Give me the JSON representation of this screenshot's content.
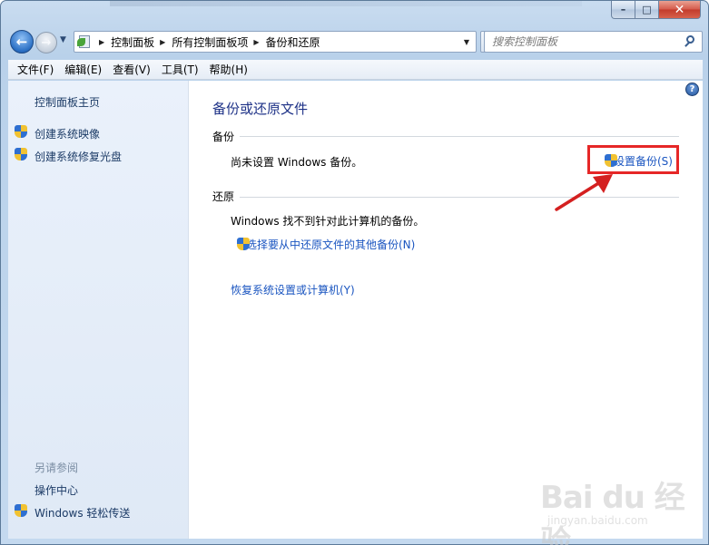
{
  "window": {
    "caption_min": "–",
    "caption_max": "□",
    "caption_close": "✕"
  },
  "nav": {
    "back_glyph": "←",
    "forward_glyph": "→",
    "history_glyph": "▼",
    "breadcrumbs": [
      "控制面板",
      "所有控制面板项",
      "备份和还原"
    ],
    "crumb_sep": "▶",
    "address_dropdown": "▼",
    "refresh_glyph": "⟳",
    "search_placeholder": "搜索控制面板"
  },
  "menubar": {
    "items": [
      "文件(F)",
      "编辑(E)",
      "查看(V)",
      "工具(T)",
      "帮助(H)"
    ]
  },
  "sidebar": {
    "home": "控制面板主页",
    "links": [
      "创建系统映像",
      "创建系统修复光盘"
    ],
    "see_also_title": "另请参阅",
    "see_also": [
      "操作中心",
      "Windows 轻松传送"
    ]
  },
  "main": {
    "help_glyph": "?",
    "title": "备份或还原文件",
    "backup": {
      "header": "备份",
      "status": "尚未设置 Windows 备份。",
      "setup_link": "设置备份(S)"
    },
    "restore": {
      "header": "还原",
      "status": "Windows 找不到针对此计算机的备份。",
      "other_link": "选择要从中还原文件的其他备份(N)",
      "recover_link": "恢复系统设置或计算机(Y)"
    }
  },
  "watermark": {
    "logo": "Bai du 经验",
    "url": "jingyan.baidu.com"
  },
  "colors": {
    "link": "#1a55c0",
    "title": "#1e3287",
    "highlight": "#e62727"
  }
}
